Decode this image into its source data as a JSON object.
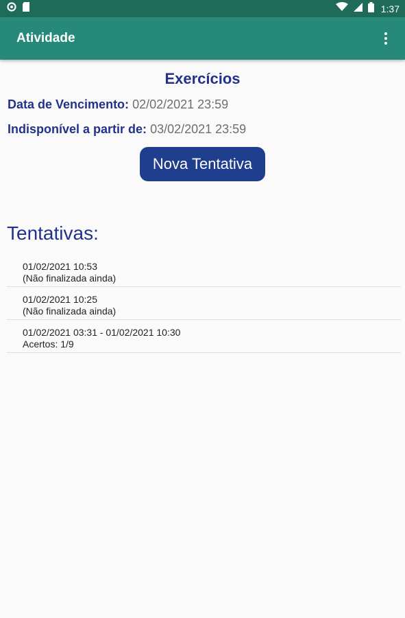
{
  "status_bar": {
    "time": "1:37",
    "left_icons": [
      "circle-notification-icon",
      "sd-card-icon"
    ],
    "right_icons": [
      "wifi-icon",
      "signal-icon",
      "battery-icon"
    ]
  },
  "app_bar": {
    "title": "Atividade",
    "menu_icon": "more-vert-icon",
    "color": "#26897a"
  },
  "activity": {
    "title": "Exercícios",
    "due_label": "Data de Vencimento:",
    "due_value": "02/02/2021 23:59",
    "unavailable_label": "Indisponível a partir de:",
    "unavailable_value": "03/02/2021 23:59",
    "new_attempt_label": "Nova Tentativa"
  },
  "attempts": {
    "heading": "Tentativas:",
    "items": [
      {
        "line1": "01/02/2021 10:53",
        "line2": "(Não finalizada ainda)"
      },
      {
        "line1": "01/02/2021 10:25",
        "line2": "(Não finalizada ainda)"
      },
      {
        "line1": "01/02/2021 03:31 - 01/02/2021 10:30",
        "line2": "Acertos: 1/9"
      }
    ]
  },
  "colors": {
    "accent_blue": "#22328a",
    "button_blue": "#1f3e8e",
    "status_bar": "#1f6b5a"
  }
}
